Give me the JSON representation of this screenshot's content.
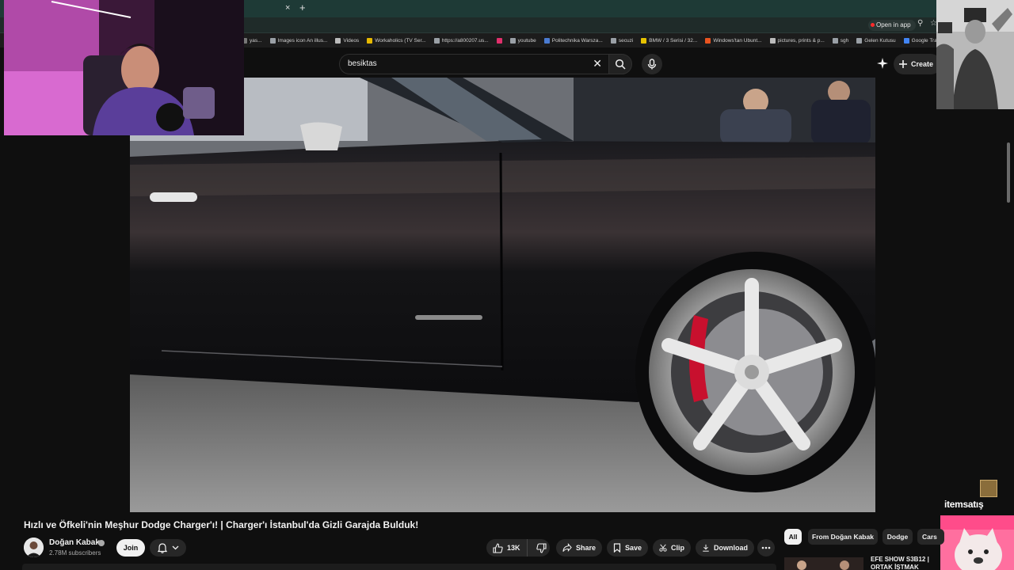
{
  "browser": {
    "tab_close": "×",
    "tab_new": "+",
    "open_in_app": "Open in app",
    "bookmarks": [
      {
        "label": "yas...",
        "color": "#777777"
      },
      {
        "label": "Images icon An illus...",
        "color": "#9aa0a6"
      },
      {
        "label": "Videos",
        "color": "#bbbbbb"
      },
      {
        "label": "Workaholics (TV Ser...",
        "color": "#e6b800"
      },
      {
        "label": "https://a800207.us...",
        "color": "#9aa0a6"
      },
      {
        "label": "",
        "color": "#e1306c"
      },
      {
        "label": "youtube",
        "color": "#9aa0a6"
      },
      {
        "label": "Politechnika Warsza...",
        "color": "#4a7bd1"
      },
      {
        "label": "secuzi",
        "color": "#9aa0a6"
      },
      {
        "label": "BMW / 3 Serisi / 32...",
        "color": "#e6c200"
      },
      {
        "label": "Windows'tan Ubunt...",
        "color": "#e95420"
      },
      {
        "label": "pictures, prints & p...",
        "color": "#bbbbbb"
      },
      {
        "label": "sgh",
        "color": "#9aa0a6"
      },
      {
        "label": "Gelen Kutusu",
        "color": "#9aa0a6"
      },
      {
        "label": "Google Translate",
        "color": "#4285f4"
      }
    ]
  },
  "header": {
    "search_value": "besiktas",
    "search_clear": "✕",
    "create_label": "Create"
  },
  "video": {
    "title": "Hızlı ve Öfkeli'nin Meşhur Dodge Charger'ı! | Charger'ı İstanbul'da Gizli Garajda Bulduk!",
    "channel": "Doğan Kabak",
    "subscribers": "2.78M subscribers",
    "join_label": "Join",
    "like_count": "13K",
    "share_label": "Share",
    "save_label": "Save",
    "clip_label": "Clip",
    "download_label": "Download"
  },
  "chips": [
    "All",
    "From Doğan Kabak",
    "Dodge",
    "Cars"
  ],
  "next_video": {
    "title": "EFE SHOW S3B12 | ORTAK İŞTMAK"
  },
  "sponsor": {
    "text": "itemsatış"
  }
}
